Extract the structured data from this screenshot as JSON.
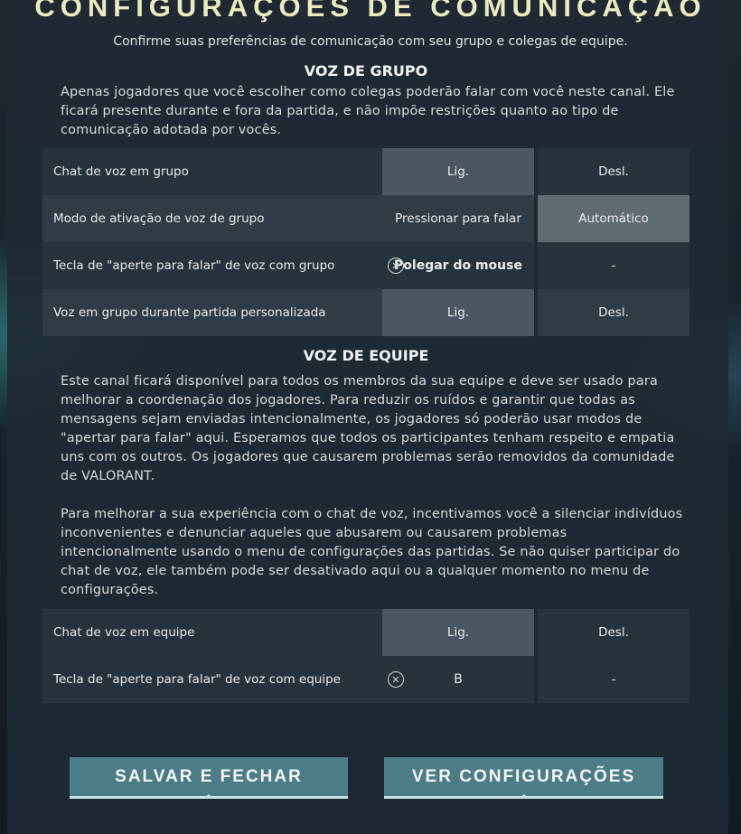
{
  "header": {
    "title": "CONFIGURAÇÕES DE COMUNICAÇÃO",
    "subtitle": "Confirme suas preferências de comunicação com seu grupo e colegas de equipe."
  },
  "group_voice": {
    "title": "VOZ DE GRUPO",
    "description": "Apenas jogadores que você escolher como colegas poderão falar com você neste canal. Ele ficará presente durante e fora da partida, e não impõe restrições quanto ao tipo de comunicação adotada por vocês.",
    "rows": [
      {
        "label": "Chat de voz em grupo",
        "opt1": "Lig.",
        "opt2": "Desl."
      },
      {
        "label": "Modo de ativação de voz de grupo",
        "opt1": "Pressionar para falar",
        "opt2": "Automático"
      },
      {
        "label": "Tecla de \"aperte para falar\" de voz com grupo",
        "key": "Polegar do mouse",
        "opt2": "-"
      },
      {
        "label": "Voz em grupo durante partida personalizada",
        "opt1": "Lig.",
        "opt2": "Desl."
      }
    ]
  },
  "team_voice": {
    "title": "VOZ DE EQUIPE",
    "description1": "Este canal ficará disponível para todos os membros da sua equipe e deve ser usado para melhorar a coordenação dos jogadores. Para reduzir os ruídos e garantir que todas as mensagens sejam enviadas intencionalmente, os jogadores só poderão usar modos de \"apertar para falar\" aqui. Esperamos que todos os participantes tenham respeito e empatia uns com os outros. Os jogadores que causarem problemas serão removidos da comunidade de VALORANT.",
    "description2": "Para melhorar a sua experiência com o chat de voz, incentivamos você a silenciar indivíduos inconvenientes e denunciar aqueles que abusarem ou causarem problemas intencionalmente usando o menu de configurações das partidas. Se não quiser participar do chat de voz, ele também pode ser desativado aqui ou a qualquer momento no menu de configurações.",
    "rows": [
      {
        "label": "Chat de voz em equipe",
        "opt1": "Lig.",
        "opt2": "Desl."
      },
      {
        "label": "Tecla de \"aperte para falar\" de voz com equipe",
        "key": "B",
        "opt2": "-"
      }
    ]
  },
  "footer": {
    "save_label": "SALVAR E FECHAR",
    "settings_label": "VER CONFIGURAÇÕES"
  },
  "icons": {
    "clear_key": "x-circle-icon"
  },
  "colors": {
    "title": "#ecebc0",
    "button": "#4c7d86",
    "button_accent": "#c7e3e3",
    "selected": "#4a5762"
  }
}
